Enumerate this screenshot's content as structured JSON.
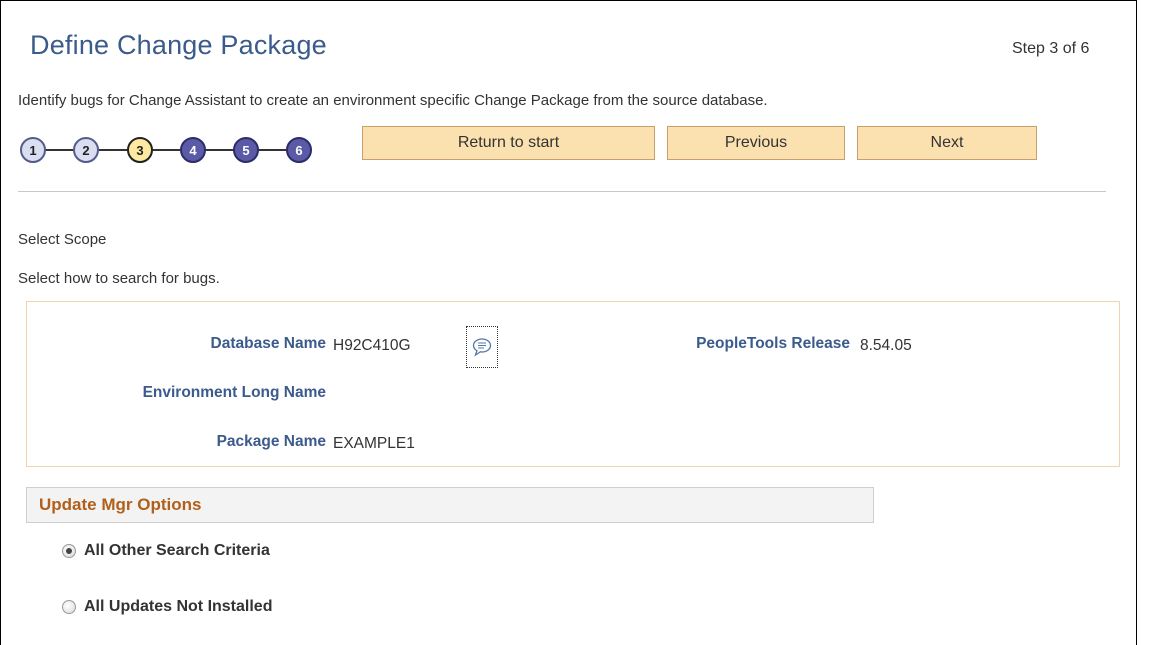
{
  "page": {
    "title": "Define Change Package",
    "step_label": "Step 3 of 6",
    "description": "Identify bugs for Change Assistant to create an environment specific Change Package from the source database."
  },
  "train": {
    "stops": [
      {
        "label": "1",
        "state": "visited"
      },
      {
        "label": "2",
        "state": "visited"
      },
      {
        "label": "3",
        "state": "current"
      },
      {
        "label": "4",
        "state": "future"
      },
      {
        "label": "5",
        "state": "future"
      },
      {
        "label": "6",
        "state": "future"
      }
    ]
  },
  "buttons": {
    "return_to_start": "Return to start",
    "previous": "Previous",
    "next": "Next"
  },
  "scope": {
    "title": "Select Scope",
    "instruction": "Select how to search for bugs."
  },
  "fields": {
    "database_name_label": "Database Name",
    "database_name_value": "H92C410G",
    "peopletools_release_label": "PeopleTools Release",
    "peopletools_release_value": "8.54.05",
    "env_long_name_label": "Environment Long Name",
    "env_long_name_value": "",
    "package_name_label": "Package Name",
    "package_name_value": "EXAMPLE1"
  },
  "update_mgr": {
    "section_title": "Update Mgr Options",
    "options": [
      {
        "label": "All Other Search Criteria",
        "checked": true
      },
      {
        "label": "All Updates Not Installed",
        "checked": false
      }
    ]
  },
  "colors": {
    "title_blue": "#3b5b8c",
    "section_orange": "#b15f1a",
    "button_bg": "#fbe1b0"
  },
  "icons": {
    "bubble": "speech-bubble-icon"
  }
}
